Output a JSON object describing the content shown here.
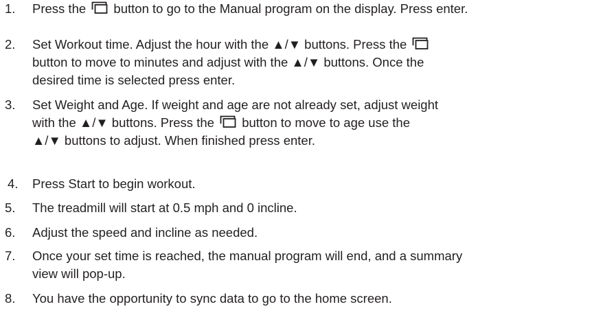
{
  "steps": [
    {
      "number": "1.",
      "lines": [
        [
          "Press the ",
          "{mode}",
          " button to go to the Manual program on the display. Press enter."
        ]
      ]
    },
    {
      "number": "2.",
      "lines": [
        [
          "Set Workout time. Adjust the hour with the ▲/▼ buttons. Press the ",
          "{mode}"
        ],
        [
          "button to move to minutes and adjust with the ▲/▼ buttons. Once the"
        ],
        [
          "desired time is selected press enter."
        ]
      ]
    },
    {
      "number": "3.",
      "lines": [
        [
          "Set Weight and Age. If weight and age are not already set, adjust weight"
        ],
        [
          "with the ▲/▼ buttons. Press the ",
          "{mode}",
          " button to move to age use the"
        ],
        [
          "▲/▼ buttons to adjust. When finished press enter."
        ]
      ]
    },
    {
      "number": "4.",
      "lines": [
        [
          "Press Start to begin workout."
        ]
      ]
    },
    {
      "number": "5.",
      "lines": [
        [
          "The treadmill will start at 0.5 mph and 0 incline."
        ]
      ]
    },
    {
      "number": "6.",
      "lines": [
        [
          "Adjust the speed and incline as needed."
        ]
      ]
    },
    {
      "number": "7.",
      "lines": [
        [
          "Once your set time is reached, the manual program will end, and a summary"
        ],
        [
          "view will pop-up."
        ]
      ]
    },
    {
      "number": "8.",
      "lines": [
        [
          "You have the opportunity to sync data to go to the home screen."
        ]
      ]
    }
  ],
  "icons": {
    "mode": "mode-button-icon"
  }
}
